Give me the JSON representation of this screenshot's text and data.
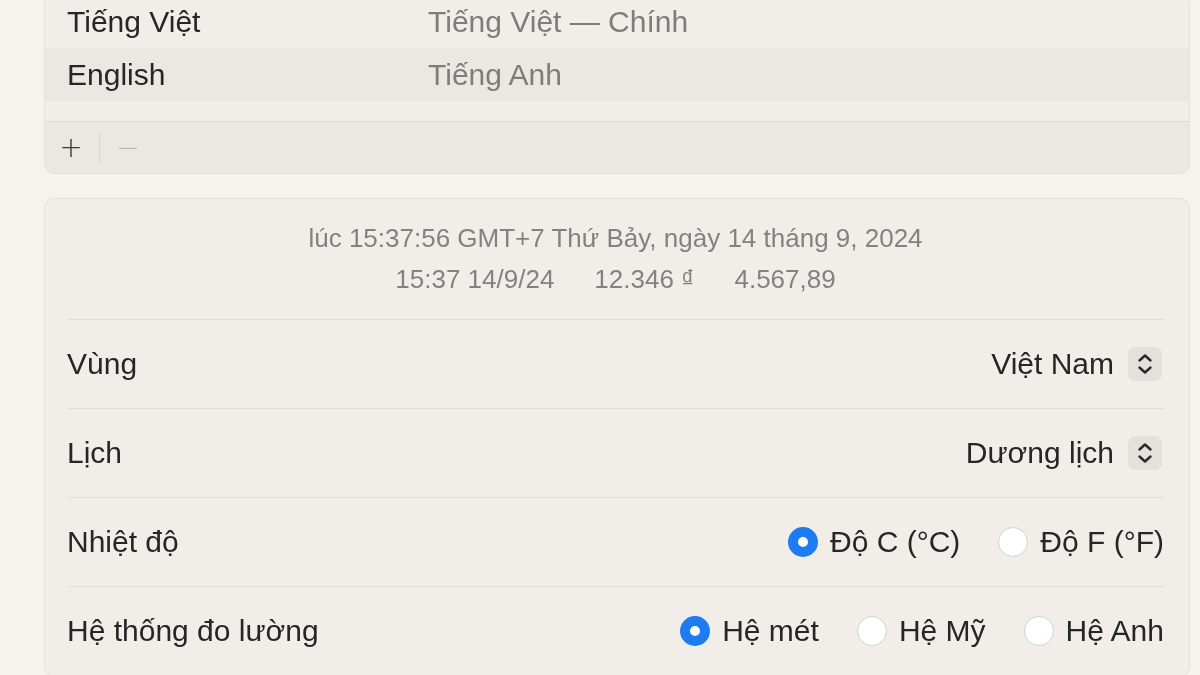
{
  "languages": {
    "rows": [
      {
        "name": "Tiếng Việt",
        "detail": "Tiếng Việt — Chính"
      },
      {
        "name": "English",
        "detail": "Tiếng Anh"
      }
    ],
    "toolbar": [
      {
        "label": "+",
        "disabled": false
      },
      {
        "label": "−",
        "disabled": true
      }
    ]
  },
  "preview": {
    "full_date": "lúc 15:37:56 GMT+7 Thứ Bảy, ngày 14 tháng 9, 2024",
    "samples": [
      "15:37 14/9/24",
      "12.346 ₫",
      "4.567,89"
    ]
  },
  "settings": [
    {
      "kind": "popup",
      "label": "Vùng",
      "value": "Việt Nam"
    },
    {
      "kind": "popup",
      "label": "Lịch",
      "value": "Dương lịch"
    },
    {
      "kind": "radio",
      "label": "Nhiệt độ",
      "options": [
        {
          "label": "Độ C (°C)",
          "selected": true
        },
        {
          "label": "Độ F (°F)",
          "selected": false
        }
      ]
    },
    {
      "kind": "radio",
      "label": "Hệ thống đo lường",
      "options": [
        {
          "label": "Hệ mét",
          "selected": true
        },
        {
          "label": "Hệ Mỹ",
          "selected": false
        },
        {
          "label": "Hệ Anh",
          "selected": false
        }
      ]
    }
  ]
}
